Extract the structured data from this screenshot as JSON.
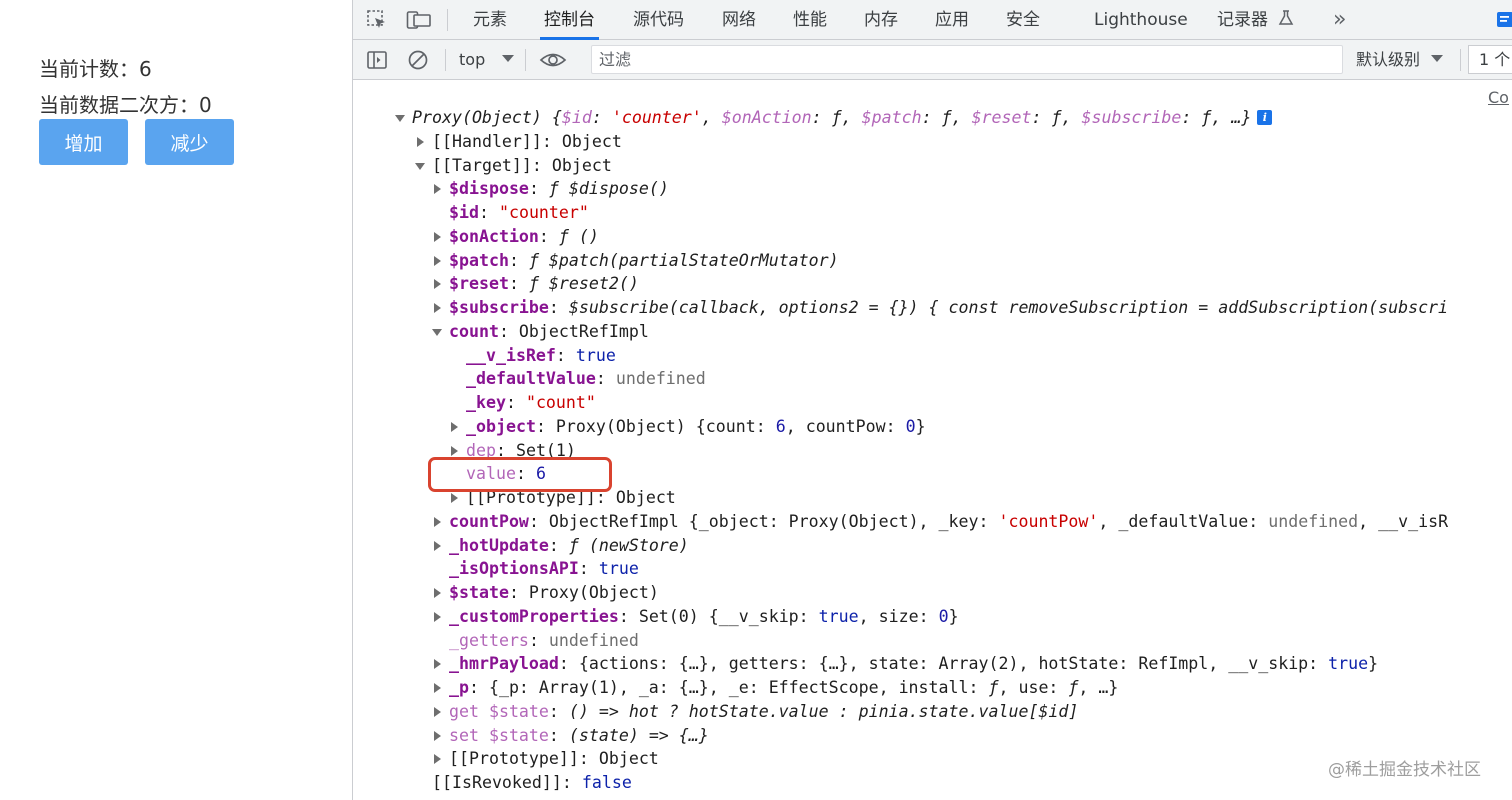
{
  "app": {
    "count_line": "当前计数：6",
    "pow_line": "当前数据二次方：0",
    "increase_button": "增加",
    "decrease_button": "减少"
  },
  "devtools": {
    "tabs": [
      "元素",
      "控制台",
      "源代码",
      "网络",
      "性能",
      "内存",
      "应用",
      "安全",
      "Lighthouse",
      "记录器"
    ],
    "active_tab": "控制台",
    "overflow_icon": "»",
    "toolbar": {
      "context": "top",
      "filter_placeholder": "过滤",
      "log_level": "默认级别",
      "issues_count": "1 个"
    },
    "console_link_fragment": "Co",
    "colors": {
      "accent": "#1a73e8",
      "highlight": "#d9432f",
      "button": "#5aa4ef"
    }
  },
  "tree": {
    "r0": [
      "Proxy(Object) ",
      "{",
      "$id",
      ": ",
      "'counter'",
      ", ",
      "$onAction",
      ": ",
      "ƒ",
      ", ",
      "$patch",
      ": ",
      "ƒ",
      ", ",
      "$reset",
      ": ",
      "ƒ",
      ", ",
      "$subscribe",
      ": ",
      "ƒ",
      ", …}"
    ],
    "r1": [
      "[[Handler]]",
      ": Object"
    ],
    "r2": [
      "[[Target]]",
      ": Object"
    ],
    "r3": [
      "$dispose",
      ": ",
      "ƒ $dispose()"
    ],
    "r4": [
      "$id",
      ": ",
      "\"counter\""
    ],
    "r5": [
      "$onAction",
      ": ",
      "ƒ ()"
    ],
    "r6": [
      "$patch",
      ": ",
      "ƒ $patch(partialStateOrMutator)"
    ],
    "r7": [
      "$reset",
      ": ",
      "ƒ $reset2()"
    ],
    "r8": [
      "$subscribe",
      ": ",
      "$subscribe(callback, options2 = {}) { const removeSubscription = addSubscription(subscri"
    ],
    "r9": [
      "count",
      ": ObjectRefImpl"
    ],
    "r10": [
      "__v_isRef",
      ": ",
      "true"
    ],
    "r11": [
      "_defaultValue",
      ": ",
      "undefined"
    ],
    "r12": [
      "_key",
      ": ",
      "\"count\""
    ],
    "r13": [
      "_object",
      ": Proxy(Object) {count: ",
      "6",
      ", countPow: ",
      "0",
      "}"
    ],
    "r14": [
      "dep",
      ": Set(1)"
    ],
    "r15": [
      "value",
      ": ",
      "6"
    ],
    "r16": [
      "[[Prototype]]",
      ": Object"
    ],
    "r17": [
      "countPow",
      ": ObjectRefImpl {_object: Proxy(Object), _key: ",
      "'countPow'",
      ", _defaultValue: ",
      "undefined",
      ", __v_isR"
    ],
    "r18": [
      "_hotUpdate",
      ": ",
      "ƒ (newStore)"
    ],
    "r19": [
      "_isOptionsAPI",
      ": ",
      "true"
    ],
    "r20": [
      "$state",
      ": Proxy(Object)"
    ],
    "r21": [
      "_customProperties",
      ": Set(0) {__v_skip: ",
      "true",
      ", size: ",
      "0",
      "}"
    ],
    "r22": [
      "_getters",
      ": ",
      "undefined"
    ],
    "r23": [
      "_hmrPayload",
      ": {actions: {…}, getters: {…}, state: Array(2), hotState: RefImpl, __v_skip: ",
      "true",
      "}"
    ],
    "r24": [
      "_p",
      ": {_p: Array(1), _a: {…}, _e: EffectScope, install: ",
      "ƒ",
      ", use: ",
      "ƒ",
      ", …}"
    ],
    "r25": [
      "get $state",
      ": ",
      "() => hot ? hotState.value : pinia.state.value[$id]"
    ],
    "r26": [
      "set $state",
      ": ",
      "(state) => {…}"
    ],
    "r27": [
      "[[Prototype]]",
      ": Object"
    ],
    "r28": [
      "[[IsRevoked]]",
      ": ",
      "false"
    ]
  },
  "watermark": "@稀土掘金技术社区"
}
